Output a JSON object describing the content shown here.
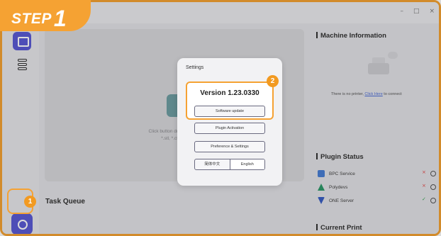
{
  "step_banner": {
    "label": "STEP",
    "number": "1"
  },
  "window": {
    "minimize": "–",
    "maximize": "□",
    "close": "×"
  },
  "main": {
    "drop_hint_line1": "Click button drag files here",
    "drop_hint_line2": "*.stl, *.ctl, *.stk",
    "task_queue_title": "Task Queue"
  },
  "right_panel": {
    "machine_info_title": "Machine Information",
    "no_printer_text": "There is no printer,",
    "click_here_link": "Click Here",
    "to_connect_text": "to connect",
    "plugin_status_title": "Plugin Status",
    "plugins": [
      {
        "name": "BPC Service",
        "status": "×",
        "status_color": "#e54848",
        "icon_color": "#4a7fd6"
      },
      {
        "name": "Polydevs",
        "status": "×",
        "status_color": "#e54848",
        "icon_color": "#2f9a6b"
      },
      {
        "name": "ONE Server",
        "status": "✓",
        "status_color": "#3aa655",
        "icon_color": "#3a5fc4"
      }
    ],
    "current_print_title": "Current Print"
  },
  "settings_dialog": {
    "title": "Settings",
    "version": "Version 1.23.0330",
    "software_update_label": "Software update",
    "plugin_activation_label": "Plugin Activation",
    "preference_label": "Preference & Settings",
    "lang_zh": "简体中文",
    "lang_en": "English",
    "selected_language": "English"
  },
  "badges": {
    "first": "1",
    "second": "2"
  },
  "colors": {
    "accent": "#f5a233",
    "brand": "#5b5bd6",
    "badge": "#f29a21"
  }
}
